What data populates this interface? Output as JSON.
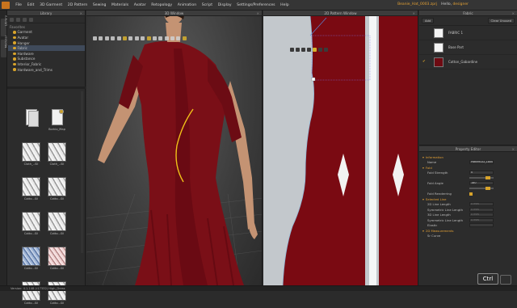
{
  "menu": {
    "items": [
      "File",
      "Edit",
      "3D Garment",
      "2D Pattern",
      "Sewing",
      "Materials",
      "Avatar",
      "Retopology",
      "Animation",
      "Script",
      "Display",
      "Settings/Preferences",
      "Help"
    ],
    "project_name": "Beanie_Hat_0003.zprj",
    "greeting": "Hello,",
    "username": "designer"
  },
  "side_tabs": [
    "Library",
    "Modular"
  ],
  "library": {
    "title": "Library",
    "tree_header": "Favorites",
    "tree": [
      "Garment",
      "Avatar",
      "Hanger",
      "Fabric",
      "Hardware",
      "Substance",
      "Interior_Fabric",
      "Hardware_and_Trims"
    ],
    "selected": "Fabric",
    "thumbnails": [
      "",
      "Borkio_Map",
      "Cloth_..Sil",
      "Cloth_..Sil",
      "Cotto...Sil",
      "Cotto...Sil",
      "Cotto...Sil",
      "Cotto...Sil",
      "Cotto...Sil",
      "Cotto...Sil",
      "Cotto...Sil",
      "Cotto...Sil"
    ]
  },
  "window_3d": {
    "title": "3D Window"
  },
  "window_2d": {
    "title": "2D Pattern Window"
  },
  "fabric_panel": {
    "title": "Fabric",
    "buttons": [
      "Add",
      "Clear Unused"
    ],
    "items": [
      {
        "name": "FABRIC 1",
        "color": "#f4f4f4",
        "checked": false
      },
      {
        "name": "Base Part",
        "color": "#f4f4f4",
        "checked": false
      },
      {
        "name": "Cotton_Gabardine",
        "color": "#6e0a12",
        "checked": true
      }
    ]
  },
  "property_editor": {
    "title": "Property Editor",
    "rows": [
      {
        "kind": "group",
        "label": "Information"
      },
      {
        "kind": "field",
        "label": "Name",
        "value": "Pattern2D_18003777"
      },
      {
        "kind": "group",
        "label": "Fold"
      },
      {
        "kind": "field",
        "label": "Fold Strength",
        "value": "0"
      },
      {
        "kind": "slider",
        "label": ""
      },
      {
        "kind": "field",
        "label": "Fold Angle",
        "value": "180"
      },
      {
        "kind": "slider",
        "label": ""
      },
      {
        "kind": "check",
        "label": "Fold Renderring"
      },
      {
        "kind": "group",
        "label": "Selected Line"
      },
      {
        "kind": "field",
        "label": "2D Line Length",
        "value": "0 mm"
      },
      {
        "kind": "field",
        "label": "Symmetric Line Length",
        "value": "0 mm"
      },
      {
        "kind": "field",
        "label": "3D Line Length",
        "value": "0 mm"
      },
      {
        "kind": "field",
        "label": "Symmetric Line Length",
        "value": "0 mm"
      },
      {
        "kind": "field",
        "label": "Elastic",
        "value": ""
      },
      {
        "kind": "group",
        "label": "2D Measurements"
      },
      {
        "kind": "field",
        "label": "Sr Curve",
        "value": ""
      }
    ]
  },
  "status": {
    "version": "Version:  4.1.148 (r17332)   High_Dress"
  },
  "shortcut": {
    "key": "Ctrl"
  }
}
